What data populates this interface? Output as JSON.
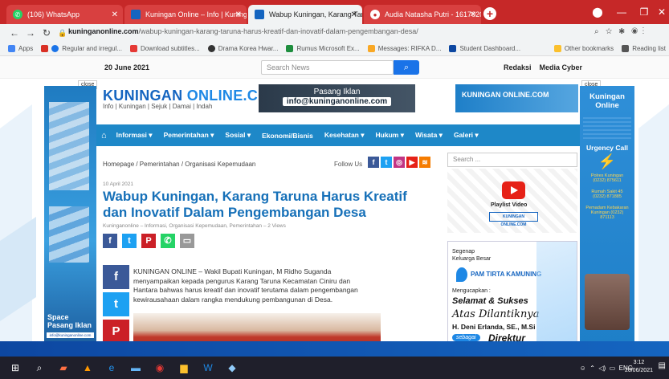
{
  "browser": {
    "tabs": [
      {
        "label": "(106) WhatsApp",
        "icon": "whatsapp-icon",
        "active": false
      },
      {
        "label": "Kuningan Online – Info | Kuning",
        "icon": "site-favicon",
        "active": false
      },
      {
        "label": "Wabup Kuningan, Karang Tarun",
        "icon": "site-favicon",
        "active": true
      },
      {
        "label": "Audia Natasha Putri - 16170200",
        "icon": "chrome-icon",
        "active": false
      }
    ],
    "url_domain": "kuninganonline.com",
    "url_path": "/wabup-kuningan-karang-taruna-harus-kreatif-dan-inovatif-dalam-pengembangan-desa/",
    "bookmarks": [
      "Apps",
      "Regular and irregul...",
      "Download subtitles...",
      "Drama Korea Hwar...",
      "Rumus Microsoft Ex...",
      "Messages: RIFKA D...",
      "Student Dashboard..."
    ],
    "bookmarks_right": [
      "Other bookmarks",
      "Reading list"
    ]
  },
  "site": {
    "date": "20 June 2021",
    "search_placeholder": "Search News",
    "toplinks": [
      "Redaksi",
      "Media Cyber"
    ],
    "close_label": "close",
    "logo_main": "KUNINGAN ",
    "logo_accent": "ONLINE.COM",
    "tagline": "Info | Kuningan | Sejuk | Damai | Indah",
    "ad_line1": "Pasang Iklan",
    "ad_line2": "info@kuninganonline.com",
    "ad_right": "KUNINGAN ONLINE.COM",
    "nav": [
      "Informasi",
      "Pemerintahan",
      "Sosial",
      "Ekonomi/Bisnis",
      "Kesehatan",
      "Hukum",
      "Wisata",
      "Galeri"
    ],
    "left_ad_line1": "Space",
    "left_ad_line2": "Pasang Iklan",
    "left_ad_email": "info@kuninganonline.com",
    "right_ad_title": "Kuningan Online",
    "right_ad_urgency": "Urgency Call",
    "right_ad_contacts": [
      "Polres Kuningan (0232) 875611",
      "Rumah Sakit 45 (0232) 871885",
      "Pemadam Kebakaran Kuningan (0232) 871113"
    ]
  },
  "article": {
    "breadcrumb": "Homepage / Pemerintahan / Organisasi Kepemudaan",
    "follow_label": "Follow Us",
    "date": "10 April 2021",
    "title": "Wabup Kuningan, Karang Taruna Harus Kreatif dan Inovatif Dalam Pengembangan Desa",
    "meta": "Kuninganonline – Informasi, Organisasi Kepemudaan, Pemerintahan – 2 Views",
    "body": "KUNINGAN ONLINE – Wakil Bupati Kuningan, M Ridho Suganda menyampaikan kepada pengurus Karang Taruna Kecamatan Ciniru dan Hantara bahwas harus kreatif dan inovatif terutama dalam pengembangan kewirausahaan dalam rangka mendukung pembangunan di Desa."
  },
  "sidebar": {
    "search_placeholder": "Search ...",
    "playlist_label": "Playlist Video",
    "greet_line1": "Segenap",
    "greet_line2": "Keluarga Besar",
    "greet_brand": "PAM TIRTA KAMUNING",
    "greet_line3": "Mengucapkan :",
    "greet_line4": "Selamat & Sukses",
    "greet_line5": "Atas Dilantiknya",
    "greet_name": "H. Deni Erlanda, SE., M.Si",
    "greet_line6": "sebagai",
    "greet_line7": "Direktur"
  },
  "taskbar": {
    "lang": "ENG",
    "time": "3:12",
    "date": "20/06/2021"
  },
  "colors": {
    "browser_red": "#c62828",
    "nav_blue": "#1e88c8",
    "title_blue": "#1670b8"
  }
}
